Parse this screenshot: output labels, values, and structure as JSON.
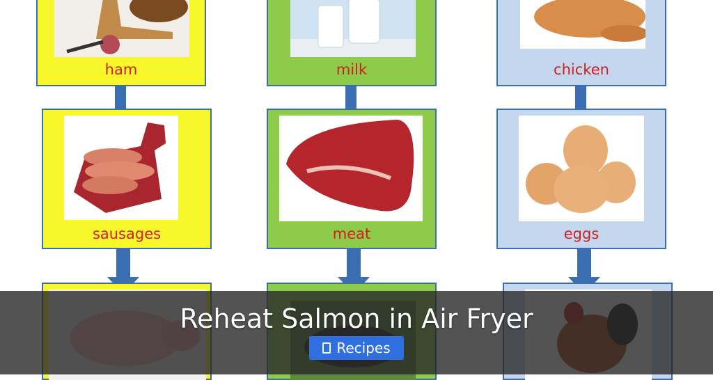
{
  "diagram": {
    "row1_labels": [
      "ham",
      "milk",
      "chicken"
    ],
    "row2_labels": [
      "sausages",
      "meat",
      "eggs"
    ],
    "row3_images": [
      "pig-image",
      "cow-image",
      "rooster-image"
    ]
  },
  "overlay": {
    "title": "Reheat Salmon in Air Fryer",
    "tag_label": "Recipes",
    "tag_icon": "folder-icon"
  },
  "colors": {
    "yellow": "#f7f72c",
    "green": "#8fcb4a",
    "blue": "#c5d7ee",
    "border": "#3b6db1",
    "label": "#d11f1f",
    "tag_button": "#2f6fe0"
  }
}
